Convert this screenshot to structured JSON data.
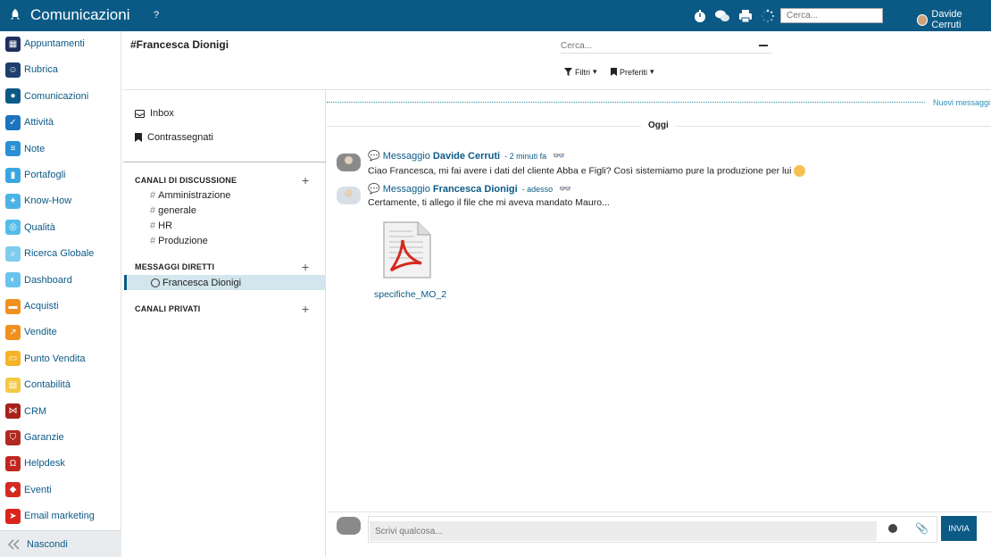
{
  "topbar": {
    "title": "Comunicazioni",
    "help": "?",
    "search_placeholder": "Cerca...",
    "user_name": "Davide Cerruti",
    "icons": [
      "rocket-icon",
      "timer-icon",
      "chat-icon",
      "print-icon",
      "spinner-icon"
    ]
  },
  "sidebar": {
    "items": [
      {
        "label": "Appuntamenti",
        "color": "#1d2f5e",
        "icon": "calendar-icon"
      },
      {
        "label": "Rubrica",
        "color": "#1d3f6e",
        "icon": "contacts-icon"
      },
      {
        "label": "Comunicazioni",
        "color": "#0b5a86",
        "icon": "chat-icon"
      },
      {
        "label": "Attività",
        "color": "#1e73be",
        "icon": "check-icon"
      },
      {
        "label": "Note",
        "color": "#2a8fd4",
        "icon": "note-icon"
      },
      {
        "label": "Portafogli",
        "color": "#3aa6e0",
        "icon": "folder-icon"
      },
      {
        "label": "Know-How",
        "color": "#4cb3e6",
        "icon": "lightbulb-icon"
      },
      {
        "label": "Qualità",
        "color": "#55bce8",
        "icon": "quality-icon"
      },
      {
        "label": "Ricerca Globale",
        "color": "#7fcdee",
        "icon": "search-icon"
      },
      {
        "label": "Dashboard",
        "color": "#69c3ec",
        "icon": "dashboard-icon"
      },
      {
        "label": "Acquisti",
        "color": "#f0901e",
        "icon": "cart-icon"
      },
      {
        "label": "Vendite",
        "color": "#f0901e",
        "icon": "chart-icon"
      },
      {
        "label": "Punto Vendita",
        "color": "#f5b428",
        "icon": "pos-icon"
      },
      {
        "label": "Contabilità",
        "color": "#f5c842",
        "icon": "accounting-icon"
      },
      {
        "label": "CRM",
        "color": "#a8201a",
        "icon": "handshake-icon"
      },
      {
        "label": "Garanzie",
        "color": "#b02a22",
        "icon": "shield-icon"
      },
      {
        "label": "Helpdesk",
        "color": "#c0271f",
        "icon": "headset-icon"
      },
      {
        "label": "Eventi",
        "color": "#d42a20",
        "icon": "ticket-icon"
      },
      {
        "label": "Email marketing",
        "color": "#d9251d",
        "icon": "send-icon"
      }
    ],
    "footer_label": "Nascondi"
  },
  "header": {
    "chat_title": "#Francesca Dionigi",
    "search_placeholder": "Cerca...",
    "filters_label": "Filtri",
    "favorites_label": "Preferiti"
  },
  "channels": {
    "inbox_label": "Inbox",
    "flagged_label": "Contrassegnati",
    "discussion_title": "CANALI DI DISCUSSIONE",
    "discussion_channels": [
      "Amministrazione",
      "generale",
      "HR",
      "Produzione"
    ],
    "direct_title": "MESSAGGI DIRETTI",
    "direct_active": "Francesca Dionigi",
    "private_title": "CANALI PRIVATI"
  },
  "messages": {
    "new_messages_label": "Nuovi messaggi",
    "today_label": "Oggi",
    "list": [
      {
        "type": "Messaggio",
        "author": "Davide Cerruti",
        "time": "- 2 minuti fa",
        "text": "Ciao Francesca, mi fai avere i dati del cliente Abba e Figli? Così sistemiamo pure la produzione per lui"
      },
      {
        "type": "Messaggio",
        "author": "Francesca Dionigi",
        "time": "- adesso",
        "text": "Certamente, ti allego il file che mi aveva mandato Mauro..."
      }
    ],
    "attachment_name": "specifiche_MO_2"
  },
  "composer": {
    "placeholder": "Scrivi qualcosa...",
    "send_label": "INVIA"
  }
}
